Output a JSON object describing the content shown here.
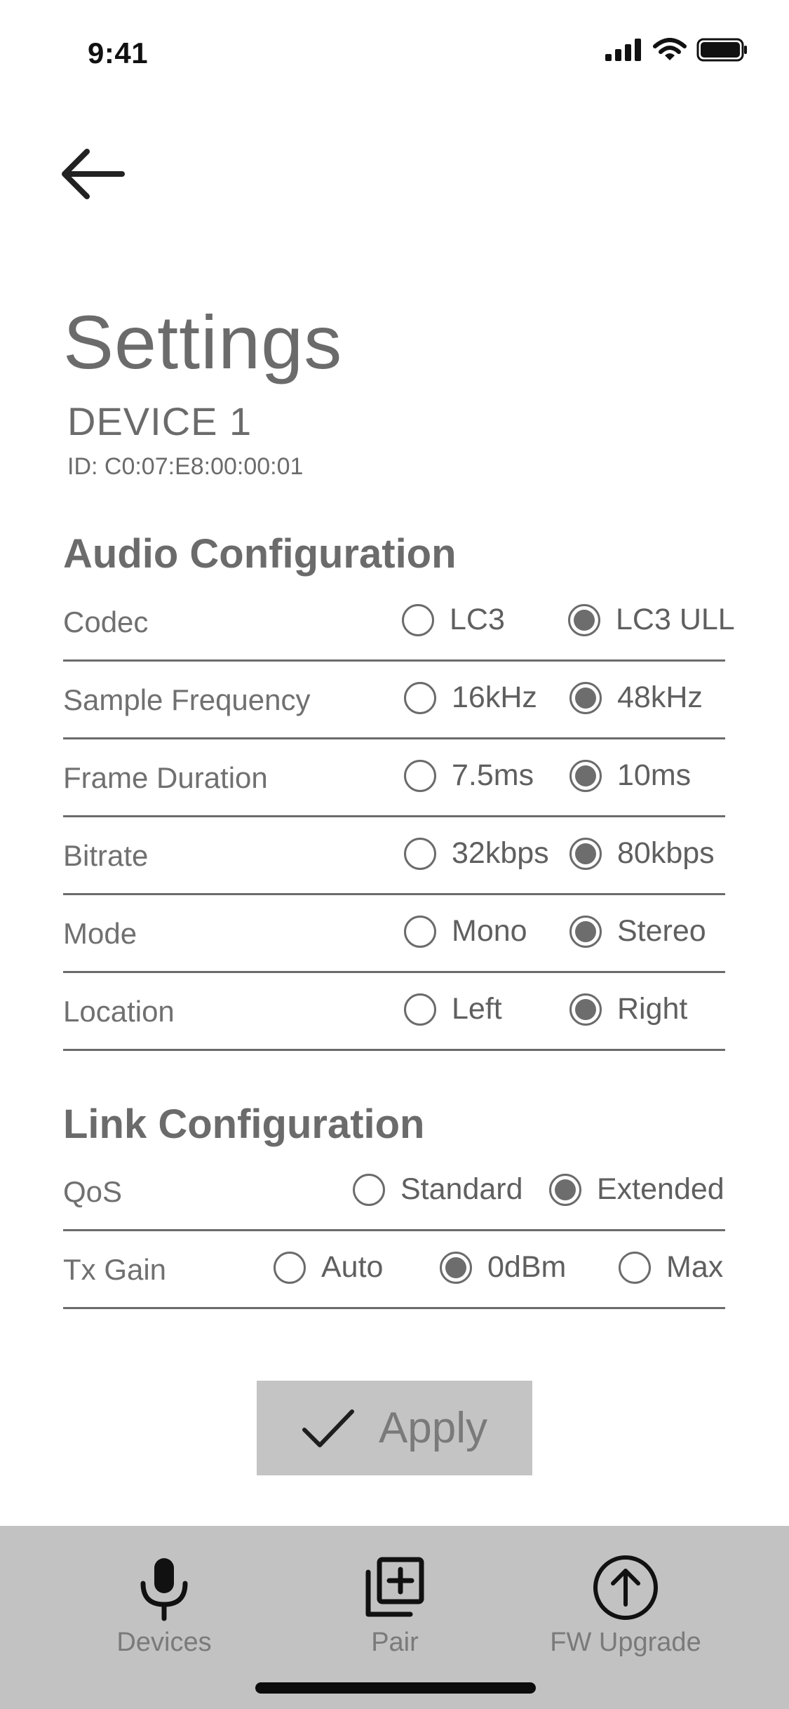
{
  "status_bar": {
    "time": "9:41"
  },
  "header": {
    "title": "Settings",
    "device_name": "DEVICE 1",
    "device_id": "ID: C0:07:E8:00:00:01"
  },
  "audio_section": {
    "title": "Audio Configuration",
    "rows": [
      {
        "label": "Codec",
        "options": [
          "LC3",
          "LC3 ULL"
        ],
        "selected": "LC3 ULL"
      },
      {
        "label": "Sample Frequency",
        "options": [
          "16kHz",
          "48kHz"
        ],
        "selected": "48kHz"
      },
      {
        "label": "Frame Duration",
        "options": [
          "7.5ms",
          "10ms"
        ],
        "selected": "10ms"
      },
      {
        "label": "Bitrate",
        "options": [
          "32kbps",
          "80kbps"
        ],
        "selected": "80kbps"
      },
      {
        "label": "Mode",
        "options": [
          "Mono",
          "Stereo"
        ],
        "selected": "Stereo"
      },
      {
        "label": "Location",
        "options": [
          "Left",
          "Right"
        ],
        "selected": "Right"
      }
    ]
  },
  "link_section": {
    "title": "Link Configuration",
    "rows": [
      {
        "label": "QoS",
        "options": [
          "Standard",
          "Extended"
        ],
        "selected": "Extended"
      },
      {
        "label": "Tx Gain",
        "options": [
          "Auto",
          "0dBm",
          "Max"
        ],
        "selected": "0dBm"
      }
    ]
  },
  "apply_button": {
    "label": "Apply",
    "icon": "checkmark-icon"
  },
  "tabbar": {
    "items": [
      {
        "label": "Devices",
        "icon": "microphone-icon"
      },
      {
        "label": "Pair",
        "icon": "add-stack-icon"
      },
      {
        "label": "FW Upgrade",
        "icon": "upload-circle-icon"
      }
    ]
  },
  "colors": {
    "text": "#6b6b6b",
    "tabbar_bg": "#c2c2c2",
    "button_bg": "#c4c4c4",
    "radio_fill": "#6d6d6d"
  }
}
